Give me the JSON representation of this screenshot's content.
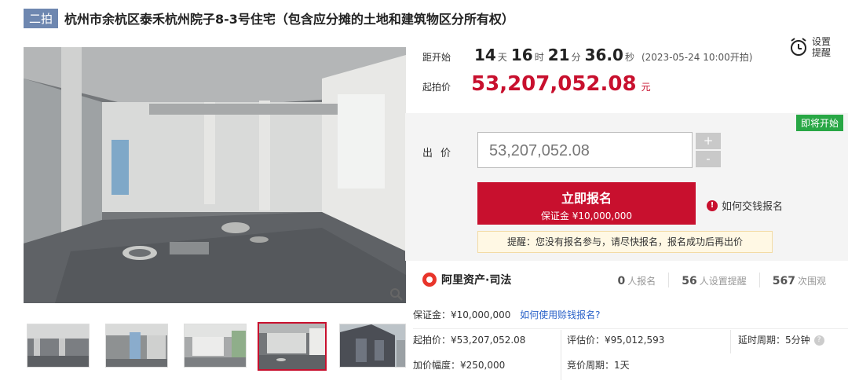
{
  "header": {
    "round_badge": "二拍",
    "title": "杭州市余杭区泰禾杭州院子8-3号住宅（包含应分摊的土地和建筑物区分所有权）"
  },
  "countdown": {
    "label": "距开始",
    "days": "14",
    "days_unit": "天",
    "hours": "16",
    "hours_unit": "时",
    "minutes": "21",
    "minutes_unit": "分",
    "seconds": "36.0",
    "seconds_unit": "秒",
    "start_text": "(2023-05-24 10:00开拍)"
  },
  "reminder": {
    "label": "设置提醒",
    "icon": "alarm-clock-icon"
  },
  "start_price": {
    "label": "起拍价",
    "value": "53,207,052.08",
    "unit": "元"
  },
  "bid": {
    "status_badge": "即将开始",
    "label": "出价",
    "input_value": "53,207,052.08",
    "plus": "+",
    "minus": "-",
    "signup_label": "立即报名",
    "signup_sub": "保证金 ¥10,000,000",
    "help_link": "如何交钱报名",
    "notice": "提醒：您没有报名参与，请尽快报名，报名成功后再出价"
  },
  "brand": {
    "name": "阿里资产·司法",
    "stats": [
      {
        "num": "0",
        "label": "人报名"
      },
      {
        "num": "56",
        "label": "人设置提醒"
      },
      {
        "num": "567",
        "label": "次围观"
      }
    ]
  },
  "details": {
    "deposit": "保证金：¥10,000,000",
    "deposit_link": "如何使用赊钱报名?",
    "start_price": "起拍价：¥53,207,052.08",
    "appraisal": "评估价：¥95,012,593",
    "delay": "延时周期：5分钟",
    "increment": "加价幅度：¥250,000",
    "cycle": "竞价周期：1天"
  },
  "colors": {
    "accent": "#c8102e",
    "badge_blue": "#6e87b0",
    "soon_green": "#28a745",
    "link": "#2a62c9"
  },
  "gallery": {
    "thumbnail_count": 5,
    "active_index": 3
  }
}
